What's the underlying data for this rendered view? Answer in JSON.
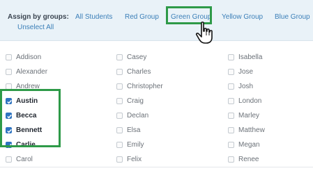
{
  "assign": {
    "label": "Assign by groups:",
    "unselect_all": "Unselect All"
  },
  "groups": [
    {
      "label": "All Students"
    },
    {
      "label": "Red Group"
    },
    {
      "label": "Green Group"
    },
    {
      "label": "Yellow Group"
    },
    {
      "label": "Blue Group"
    }
  ],
  "highlight_color": "#2e9a48",
  "checkbox_color": "#2f74c0",
  "columns": [
    {
      "students": [
        {
          "name": "Addison",
          "checked": false
        },
        {
          "name": "Alexander",
          "checked": false
        },
        {
          "name": "Andrew",
          "checked": false
        },
        {
          "name": "Austin",
          "checked": true
        },
        {
          "name": "Becca",
          "checked": true
        },
        {
          "name": "Bennett",
          "checked": true
        },
        {
          "name": "Carlie",
          "checked": true
        },
        {
          "name": "Carol",
          "checked": false
        }
      ]
    },
    {
      "students": [
        {
          "name": "Casey",
          "checked": false
        },
        {
          "name": "Charles",
          "checked": false
        },
        {
          "name": "Christopher",
          "checked": false
        },
        {
          "name": "Craig",
          "checked": false
        },
        {
          "name": "Declan",
          "checked": false
        },
        {
          "name": "Elsa",
          "checked": false
        },
        {
          "name": "Emily",
          "checked": false
        },
        {
          "name": "Felix",
          "checked": false
        }
      ]
    },
    {
      "students": [
        {
          "name": "Isabella",
          "checked": false
        },
        {
          "name": "Jose",
          "checked": false
        },
        {
          "name": "Josh",
          "checked": false
        },
        {
          "name": "London",
          "checked": false
        },
        {
          "name": "Marley",
          "checked": false
        },
        {
          "name": "Matthew",
          "checked": false
        },
        {
          "name": "Megan",
          "checked": false
        },
        {
          "name": "Renee",
          "checked": false
        }
      ]
    }
  ],
  "icons": {
    "cursor": "hand-pointer-icon",
    "check": "checkmark-icon"
  }
}
